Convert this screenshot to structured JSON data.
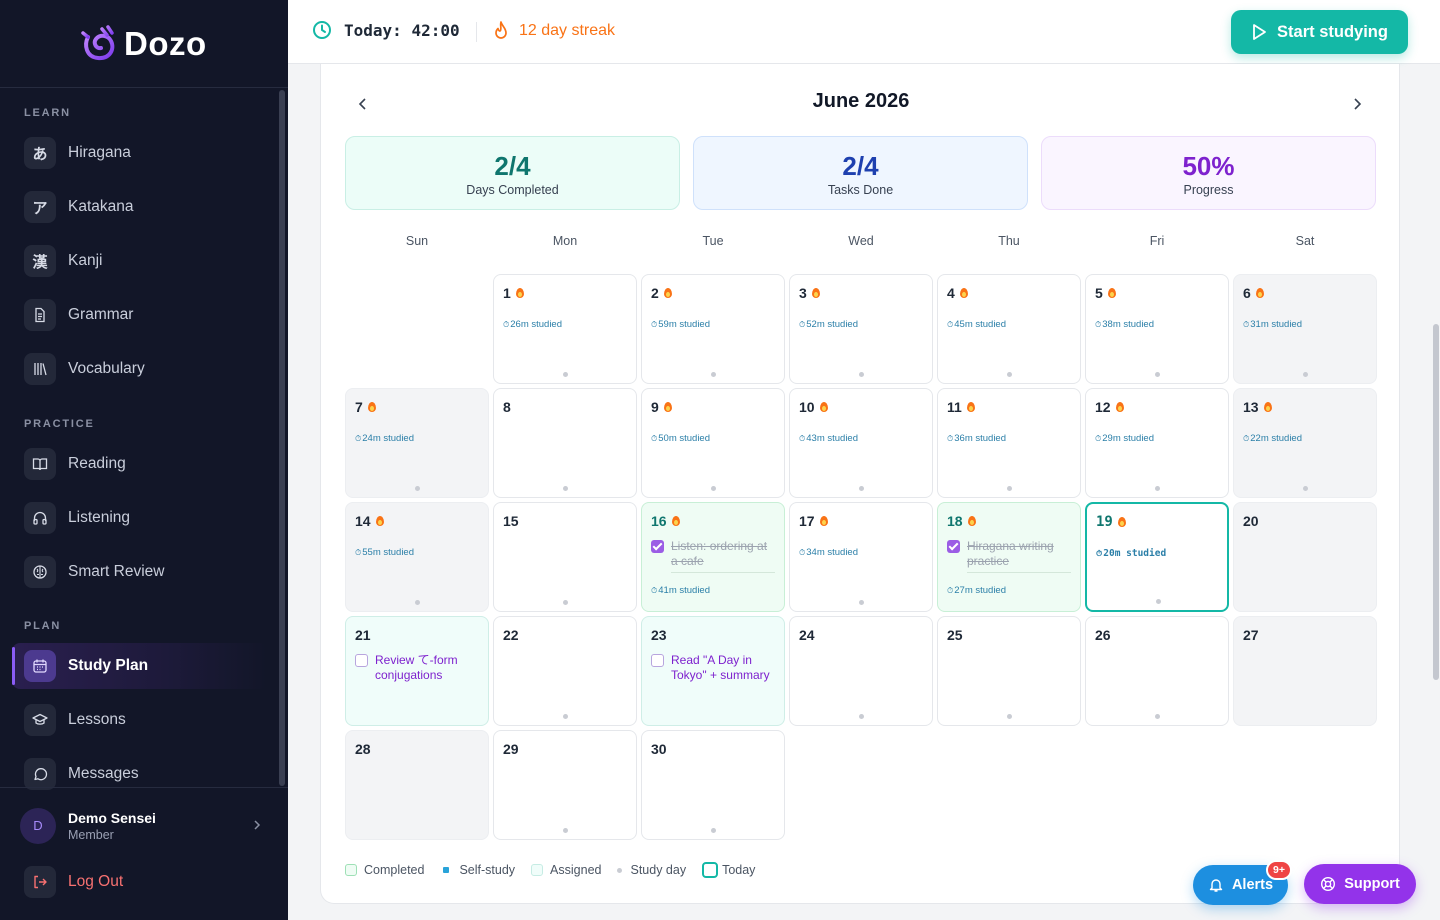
{
  "app": {
    "name": "Dozo"
  },
  "sidebar": {
    "sections": [
      {
        "label": "LEARN",
        "items": [
          {
            "id": "hiragana",
            "label": "Hiragana",
            "icon": "hiragana-a-glyph",
            "glyph": "あ"
          },
          {
            "id": "katakana",
            "label": "Katakana",
            "icon": "katakana-a-glyph",
            "glyph": "ア"
          },
          {
            "id": "kanji",
            "label": "Kanji",
            "icon": "kanji-glyph",
            "glyph": "漢"
          },
          {
            "id": "grammar",
            "label": "Grammar",
            "icon": "document-icon"
          },
          {
            "id": "vocabulary",
            "label": "Vocabulary",
            "icon": "library-icon"
          }
        ]
      },
      {
        "label": "PRACTICE",
        "items": [
          {
            "id": "reading",
            "label": "Reading",
            "icon": "book-open-icon"
          },
          {
            "id": "listening",
            "label": "Listening",
            "icon": "headphones-icon"
          },
          {
            "id": "smart-review",
            "label": "Smart Review",
            "icon": "brain-icon"
          }
        ]
      },
      {
        "label": "PLAN",
        "items": [
          {
            "id": "study-plan",
            "label": "Study Plan",
            "icon": "calendar-icon",
            "active": true
          },
          {
            "id": "lessons",
            "label": "Lessons",
            "icon": "graduation-cap-icon"
          },
          {
            "id": "messages",
            "label": "Messages",
            "icon": "chat-bubble-icon"
          }
        ]
      }
    ],
    "user": {
      "initial": "D",
      "name": "Demo Sensei",
      "role": "Member"
    },
    "logout_label": "Log Out"
  },
  "topbar": {
    "today_label": "Today:",
    "today_time": "42:00",
    "streak": "12 day streak",
    "start_button": "Start studying"
  },
  "calendar": {
    "month_title": "June 2026",
    "stats": [
      {
        "value": "2/4",
        "label": "Days Completed",
        "color": "#0f766e"
      },
      {
        "value": "2/4",
        "label": "Tasks Done",
        "color": "#1e40af"
      },
      {
        "value": "50%",
        "label": "Progress",
        "color": "#7e22ce"
      }
    ],
    "weekdays": [
      "Sun",
      "Mon",
      "Tue",
      "Wed",
      "Thu",
      "Fri",
      "Sat"
    ],
    "first_weekday": 1,
    "days": [
      {
        "day": "1",
        "fire": true,
        "studied": "26m studied"
      },
      {
        "day": "2",
        "fire": true,
        "studied": "59m studied"
      },
      {
        "day": "3",
        "fire": true,
        "studied": "52m studied"
      },
      {
        "day": "4",
        "fire": true,
        "studied": "45m studied"
      },
      {
        "day": "5",
        "fire": true,
        "studied": "38m studied"
      },
      {
        "day": "6",
        "fire": true,
        "studied": "31m studied"
      },
      {
        "day": "7",
        "fire": true,
        "studied": "24m studied"
      },
      {
        "day": "8",
        "dot": true
      },
      {
        "day": "9",
        "fire": true,
        "studied": "50m studied"
      },
      {
        "day": "10",
        "fire": true,
        "studied": "43m studied"
      },
      {
        "day": "11",
        "fire": true,
        "studied": "36m studied"
      },
      {
        "day": "12",
        "fire": true,
        "studied": "29m studied"
      },
      {
        "day": "13",
        "fire": true,
        "studied": "22m studied"
      },
      {
        "day": "14",
        "fire": true,
        "studied": "55m studied"
      },
      {
        "day": "15",
        "dot": true
      },
      {
        "day": "16",
        "fire": true,
        "status": "done",
        "task": "Listen: ordering at a cafe",
        "task_done": true,
        "studied": "41m studied"
      },
      {
        "day": "17",
        "fire": true,
        "studied": "34m studied"
      },
      {
        "day": "18",
        "fire": true,
        "status": "done",
        "task": "Hiragana writing practice",
        "task_done": true,
        "studied": "27m studied"
      },
      {
        "day": "19",
        "fire": true,
        "status": "today",
        "studied": "20m studied"
      },
      {
        "day": "20"
      },
      {
        "day": "21",
        "status": "assigned",
        "task": "Review て-form conjugations",
        "task_done": false
      },
      {
        "day": "22",
        "dot": true
      },
      {
        "day": "23",
        "status": "assigned",
        "task": "Read \"A Day in Tokyo\" + summary",
        "task_done": false
      },
      {
        "day": "24",
        "dot": true
      },
      {
        "day": "25",
        "dot": true
      },
      {
        "day": "26",
        "dot": true
      },
      {
        "day": "27"
      },
      {
        "day": "28"
      },
      {
        "day": "29",
        "dot": true
      },
      {
        "day": "30",
        "dot": true
      }
    ],
    "legend": [
      {
        "label": "Completed",
        "swatch": "completed"
      },
      {
        "label": "Self-study",
        "swatch": "self-study"
      },
      {
        "label": "Assigned",
        "swatch": "assigned"
      },
      {
        "label": "Study day",
        "swatch": "study-day"
      },
      {
        "label": "Today",
        "swatch": "today"
      }
    ]
  },
  "floating": {
    "alerts_label": "Alerts",
    "alerts_badge": "9+",
    "support_label": "Support"
  },
  "colors": {
    "accent_teal": "#14b8a6",
    "brand_purple": "#9333ea",
    "sidebar_bg": "#121628",
    "streak_orange": "#f97316"
  }
}
